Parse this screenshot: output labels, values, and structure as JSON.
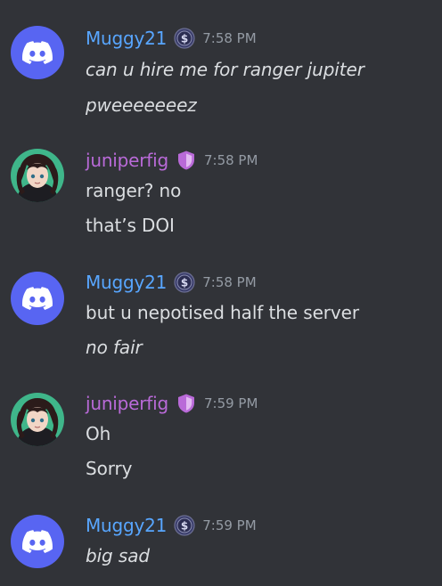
{
  "messages": [
    {
      "author": "Muggy21",
      "time": "7:58 PM",
      "lines": [
        "can u hire me for ranger jupiter",
        "pweeeeeeez"
      ]
    },
    {
      "author": "juniperfig",
      "time": "7:58 PM",
      "lines": [
        "ranger? no",
        "that’s DOI"
      ]
    },
    {
      "author": "Muggy21",
      "time": "7:58 PM",
      "lines": [
        "but u nepotised half the server",
        "no fair"
      ]
    },
    {
      "author": "juniperfig",
      "time": "7:59 PM",
      "lines": [
        "Oh",
        "Sorry"
      ]
    },
    {
      "author": "Muggy21",
      "time": "7:59 PM",
      "lines": [
        "big sad"
      ]
    }
  ],
  "icons": {
    "muggy_avatar": "discord-logo-icon",
    "muggy_badge": "dollar-coin-icon",
    "juniper_avatar": "anime-character-avatar",
    "juniper_badge": "purple-shield-icon"
  },
  "colors": {
    "background": "#313338",
    "muggy_name": "#58a6ff",
    "juniper_name": "#b96ad8",
    "text": "#dbdee1",
    "timestamp": "#949ba4",
    "discord_blurple": "#5865f2"
  }
}
